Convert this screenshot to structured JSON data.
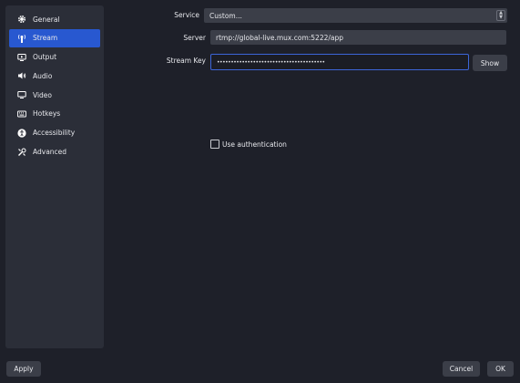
{
  "sidebar": {
    "items": [
      {
        "label": "General",
        "icon": "gear-icon"
      },
      {
        "label": "Stream",
        "icon": "antenna-icon",
        "active": true
      },
      {
        "label": "Output",
        "icon": "monitor-output-icon"
      },
      {
        "label": "Audio",
        "icon": "speaker-icon"
      },
      {
        "label": "Video",
        "icon": "monitor-icon"
      },
      {
        "label": "Hotkeys",
        "icon": "keyboard-icon"
      },
      {
        "label": "Accessibility",
        "icon": "accessibility-icon"
      },
      {
        "label": "Advanced",
        "icon": "wrench-icon"
      }
    ]
  },
  "form": {
    "service_label": "Service",
    "service_value": "Custom...",
    "server_label": "Server",
    "server_value": "rtmp://global-live.mux.com:5222/app",
    "stream_key_label": "Stream Key",
    "stream_key_value": "•••••••••••••••••••••••••••••••••••••••",
    "show_label": "Show",
    "use_auth_label": "Use authentication"
  },
  "footer": {
    "apply_label": "Apply",
    "cancel_label": "Cancel",
    "ok_label": "OK"
  },
  "colors": {
    "background": "#1e2029",
    "panel": "#2b2e38",
    "accent": "#2858d0",
    "field": "#3b3e48"
  }
}
